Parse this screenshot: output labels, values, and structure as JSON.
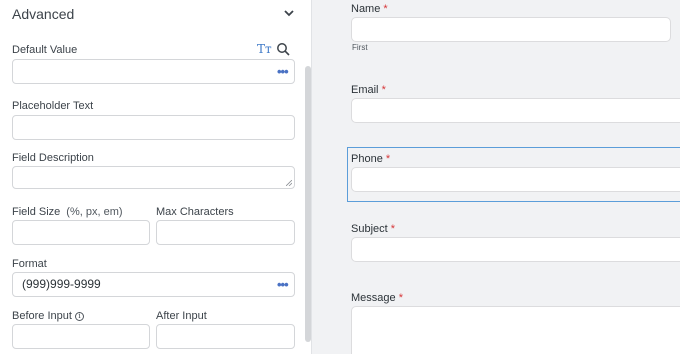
{
  "settings": {
    "section_title": "Advanced",
    "default_value": {
      "label": "Default Value",
      "value": ""
    },
    "placeholder_text": {
      "label": "Placeholder Text",
      "value": ""
    },
    "field_description": {
      "label": "Field Description",
      "value": ""
    },
    "field_size": {
      "label": "Field Size",
      "hint": "(%, px, em)",
      "value": ""
    },
    "max_characters": {
      "label": "Max Characters",
      "value": ""
    },
    "format": {
      "label": "Format",
      "value": "(999)999-9999"
    },
    "before_input": {
      "label": "Before Input",
      "value": ""
    },
    "after_input": {
      "label": "After Input",
      "value": ""
    },
    "more_symbol": "•••",
    "text_icon_glyph": "Tт"
  },
  "preview": {
    "name": {
      "label": "Name",
      "sublabel": "First"
    },
    "email": {
      "label": "Email"
    },
    "phone": {
      "label": "Phone"
    },
    "subject": {
      "label": "Subject"
    },
    "message": {
      "label": "Message"
    },
    "required_mark": "*"
  },
  "colors": {
    "accent": "#3f7ac8",
    "required": "#d63638",
    "selected_border": "#5b9dd9"
  }
}
